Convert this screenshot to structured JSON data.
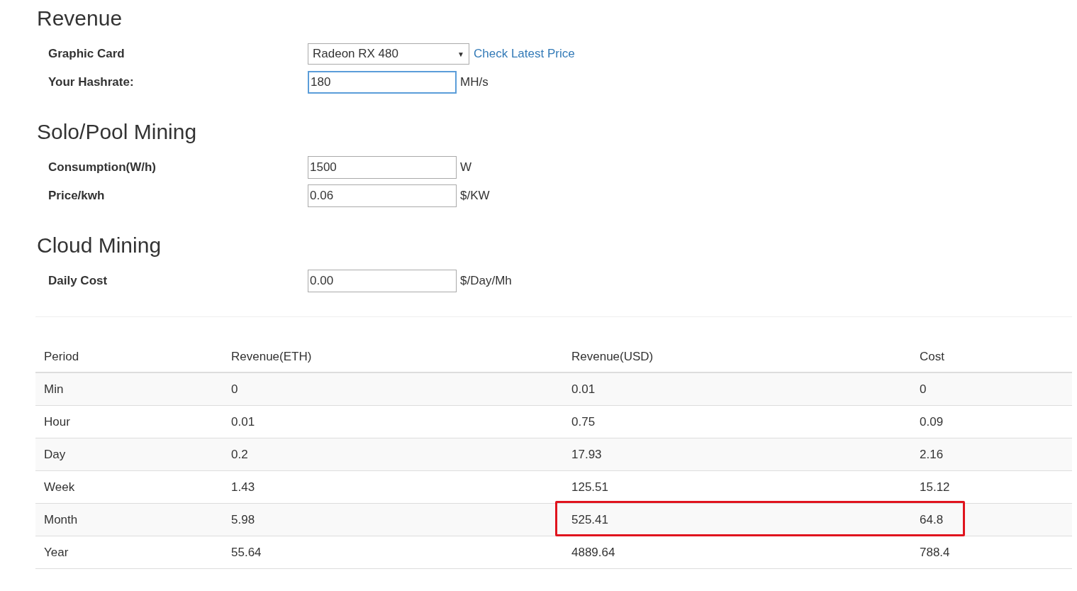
{
  "sections": [
    {
      "title": "Revenue",
      "fields": [
        {
          "kind": "select",
          "label": "Graphic Card",
          "value": "Radeon RX 480",
          "arrow": "▼",
          "link": "Check Latest Price"
        },
        {
          "kind": "input",
          "label": "Your Hashrate:",
          "value": "180",
          "unit": "MH/s",
          "focused": true
        }
      ]
    },
    {
      "title": "Solo/Pool Mining",
      "fields": [
        {
          "kind": "input",
          "label": "Consumption(W/h)",
          "value": "1500",
          "unit": "W",
          "focused": false
        },
        {
          "kind": "input",
          "label": "Price/kwh",
          "value": "0.06",
          "unit": "$/KW",
          "focused": false
        }
      ]
    },
    {
      "title": "Cloud Mining",
      "fields": [
        {
          "kind": "input",
          "label": "Daily Cost",
          "value": "0.00",
          "unit": "$/Day/Mh",
          "focused": false
        }
      ]
    }
  ],
  "table": {
    "columns": [
      "Period",
      "Revenue(ETH)",
      "Revenue(USD)",
      "Cost"
    ],
    "rows": [
      {
        "cells": [
          "Min",
          "0",
          "0.01",
          "0"
        ],
        "highlighted": false
      },
      {
        "cells": [
          "Hour",
          "0.01",
          "0.75",
          "0.09"
        ],
        "highlighted": false
      },
      {
        "cells": [
          "Day",
          "0.2",
          "17.93",
          "2.16"
        ],
        "highlighted": false
      },
      {
        "cells": [
          "Week",
          "1.43",
          "125.51",
          "15.12"
        ],
        "highlighted": false
      },
      {
        "cells": [
          "Month",
          "5.98",
          "525.41",
          "64.8"
        ],
        "highlighted": true
      },
      {
        "cells": [
          "Year",
          "55.64",
          "4889.64",
          "788.4"
        ],
        "highlighted": false
      }
    ]
  }
}
